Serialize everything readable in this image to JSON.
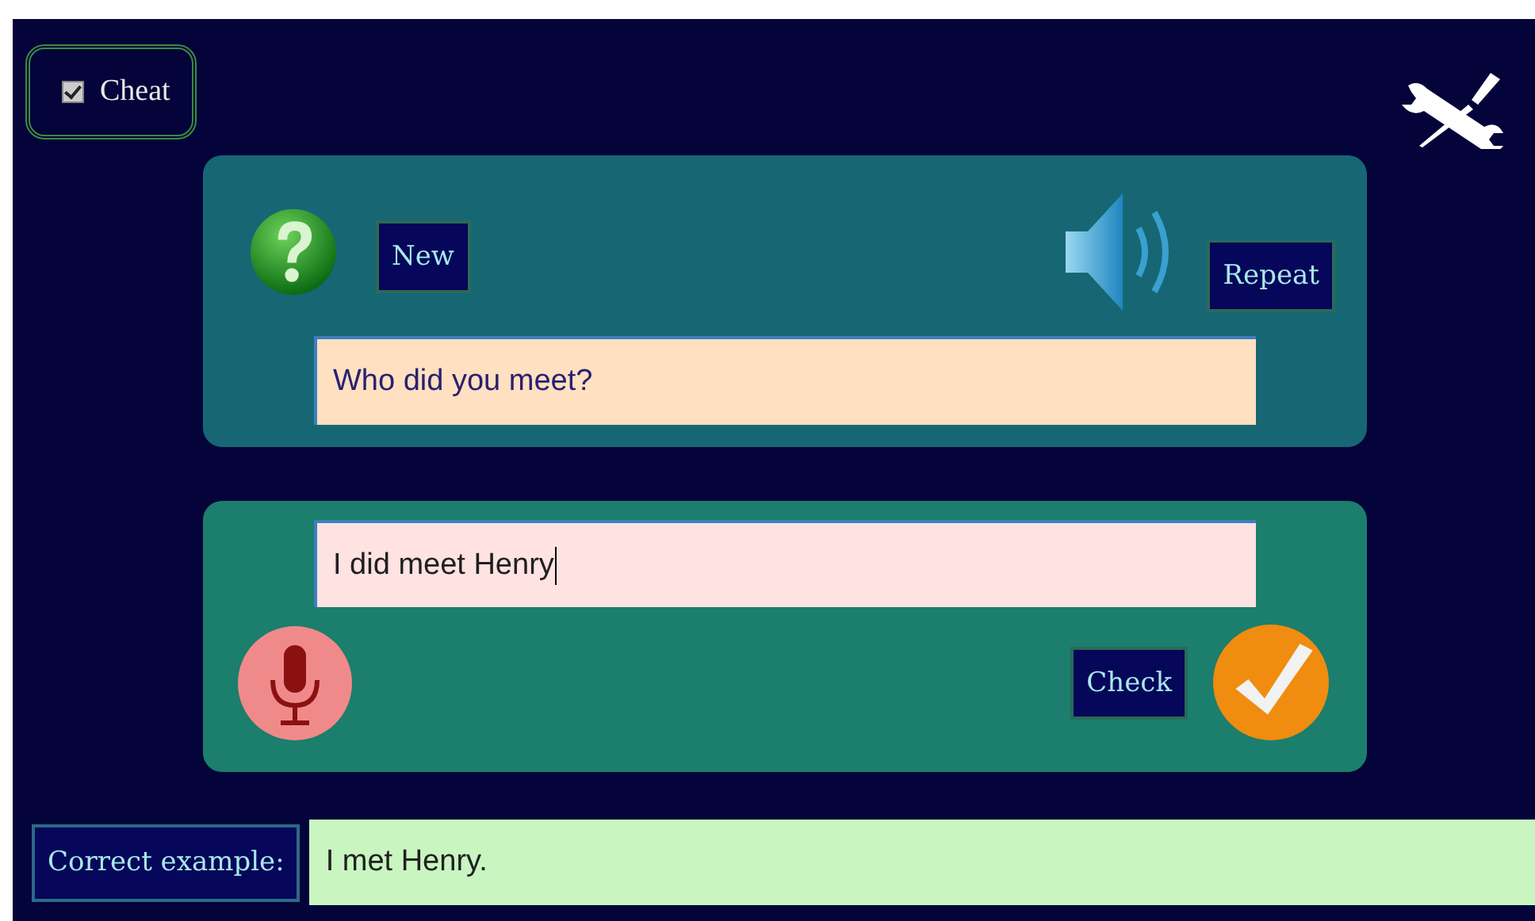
{
  "cheat": {
    "label": "Cheat",
    "checked": true
  },
  "question_panel": {
    "new_button": "New",
    "repeat_button": "Repeat",
    "question": "Who did you meet?"
  },
  "answer_panel": {
    "answer": "I did meet Henry",
    "check_button": "Check"
  },
  "correct_example": {
    "label": "Correct example:",
    "text": "I met Henry."
  }
}
